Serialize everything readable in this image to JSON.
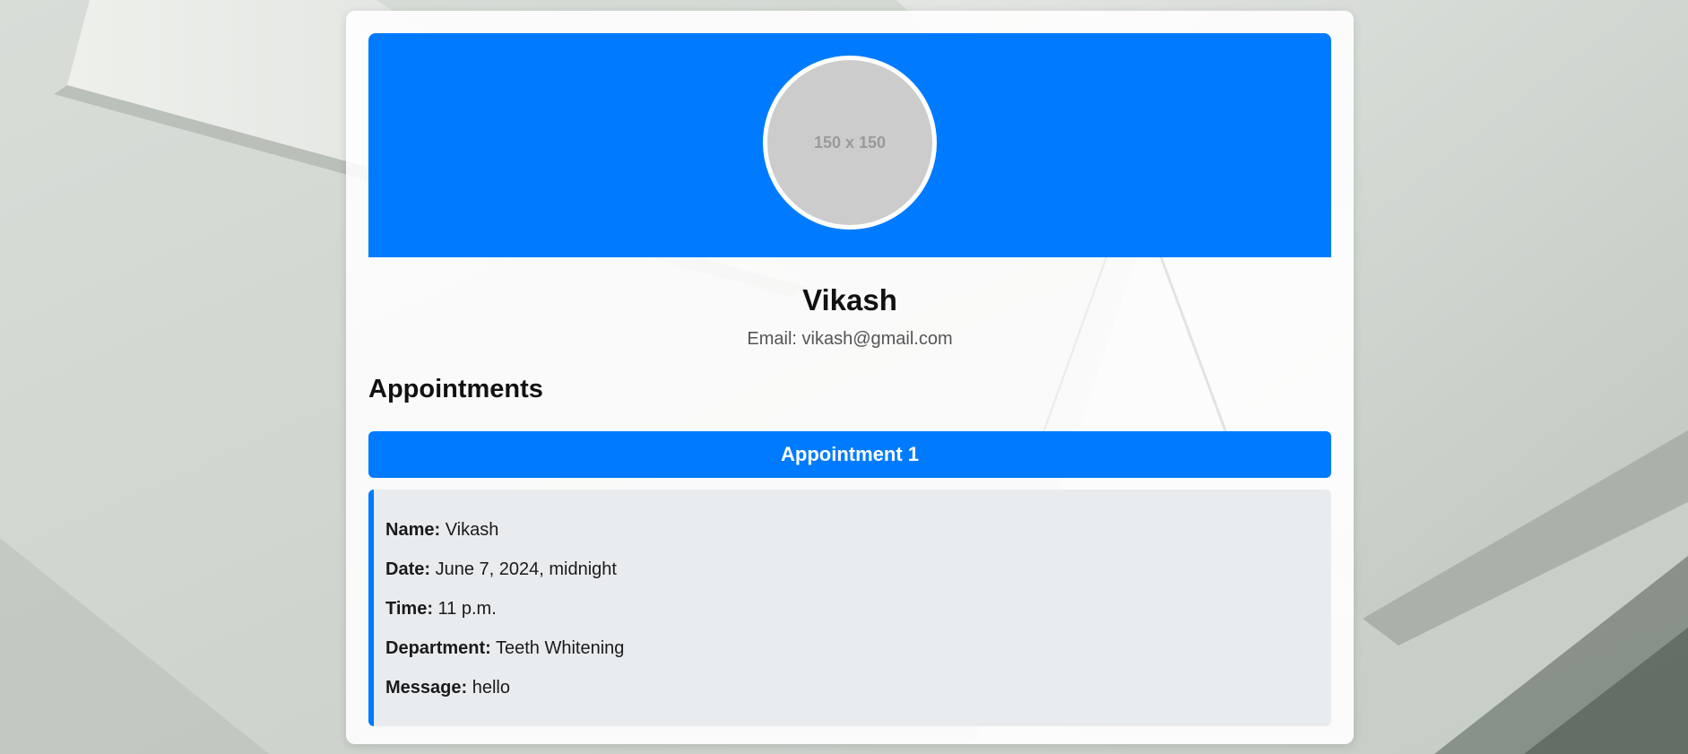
{
  "avatar": {
    "placeholder_text": "150 x 150"
  },
  "profile": {
    "name": "Vikash",
    "email": "Email: vikash@gmail.com"
  },
  "appointments_section": {
    "title": "Appointments"
  },
  "appointments": [
    {
      "header": "Appointment 1",
      "fields": {
        "name_label": "Name:",
        "name_value": "Vikash",
        "date_label": "Date:",
        "date_value": "June 7, 2024, midnight",
        "time_label": "Time:",
        "time_value": "11 p.m.",
        "department_label": "Department:",
        "department_value": "Teeth Whitening",
        "message_label": "Message:",
        "message_value": "hello"
      }
    }
  ],
  "colors": {
    "accent": "#007bff",
    "detail_background": "#e9ecef",
    "avatar_placeholder": "#cccccc"
  }
}
